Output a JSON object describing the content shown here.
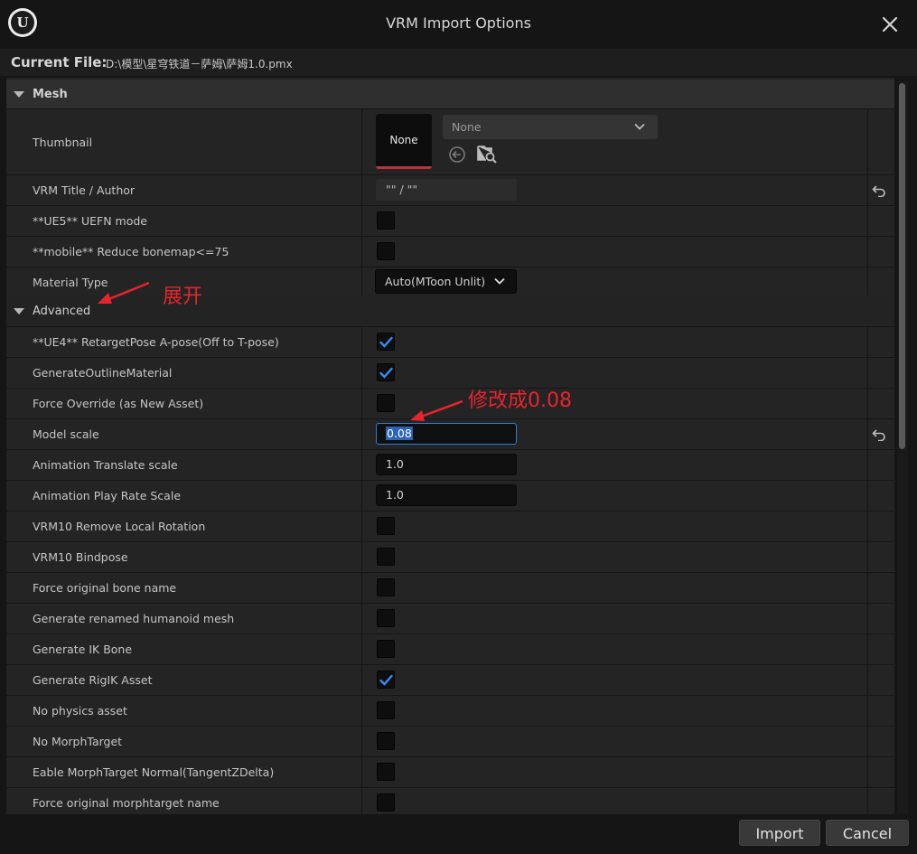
{
  "window": {
    "title": "VRM Import Options"
  },
  "file": {
    "label": "Current File:",
    "path": "D:\\模型\\星穹铁道－萨姆\\萨姆1.0.pmx"
  },
  "mesh_section": {
    "label": "Mesh"
  },
  "thumbnail": {
    "label": "Thumbnail",
    "preview": "None",
    "asset": "None"
  },
  "title_author": {
    "label": "VRM Title / Author",
    "value": "\"\" / \"\""
  },
  "uefn": {
    "label": "**UE5** UEFN mode",
    "checked": false
  },
  "mobile": {
    "label": "**mobile** Reduce bonemap<=75",
    "checked": false
  },
  "material": {
    "label": "Material Type",
    "value": "Auto(MToon Unlit)"
  },
  "advanced_section": {
    "label": "Advanced"
  },
  "rows": [
    {
      "label": "**UE4** RetargetPose A-pose(Off to T-pose)",
      "kind": "check",
      "checked": true
    },
    {
      "label": "GenerateOutlineMaterial",
      "kind": "check",
      "checked": true
    },
    {
      "label": "Force Override (as New Asset)",
      "kind": "check",
      "checked": false
    },
    {
      "label": "Model scale",
      "kind": "text",
      "value": "0.08",
      "focused": true,
      "reset": true
    },
    {
      "label": "Animation Translate scale",
      "kind": "text",
      "value": "1.0"
    },
    {
      "label": "Animation Play Rate Scale",
      "kind": "text",
      "value": "1.0"
    },
    {
      "label": "VRM10 Remove Local Rotation",
      "kind": "check",
      "checked": false
    },
    {
      "label": "VRM10 Bindpose",
      "kind": "check",
      "checked": false
    },
    {
      "label": "Force original bone name",
      "kind": "check",
      "checked": false
    },
    {
      "label": "Generate renamed humanoid mesh",
      "kind": "check",
      "checked": false
    },
    {
      "label": "Generate IK Bone",
      "kind": "check",
      "checked": false
    },
    {
      "label": "Generate RigIK Asset",
      "kind": "check",
      "checked": true
    },
    {
      "label": "No physics asset",
      "kind": "check",
      "checked": false
    },
    {
      "label": "No MorphTarget",
      "kind": "check",
      "checked": false
    },
    {
      "label": "Eable MorphTarget Normal(TangentZDelta)",
      "kind": "check",
      "checked": false
    },
    {
      "label": "Force original morphtarget name",
      "kind": "check",
      "checked": false
    }
  ],
  "buttons": {
    "import": "Import",
    "cancel": "Cancel"
  },
  "annotations": {
    "expand": "展开",
    "change": "修改成0.08"
  },
  "colors": {
    "accent": "#2a7fe0",
    "check": "#3b8bf0",
    "annotation": "#e8242d"
  }
}
